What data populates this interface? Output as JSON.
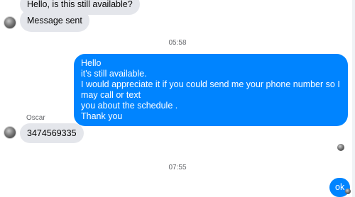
{
  "conversation": {
    "partial_message": "Hello, is this still available?",
    "message_sent": "Message sent",
    "timestamp_1": "05:58",
    "reply_lines": [
      "Hello",
      "it's still available.",
      "I would appreciate it if you could send me your phone number so I may call or text",
      "you about the schedule .",
      "Thank you"
    ],
    "sender_name": "Oscar",
    "phone_message": "3474569335",
    "timestamp_2": "07:55",
    "last_message": "ok"
  }
}
